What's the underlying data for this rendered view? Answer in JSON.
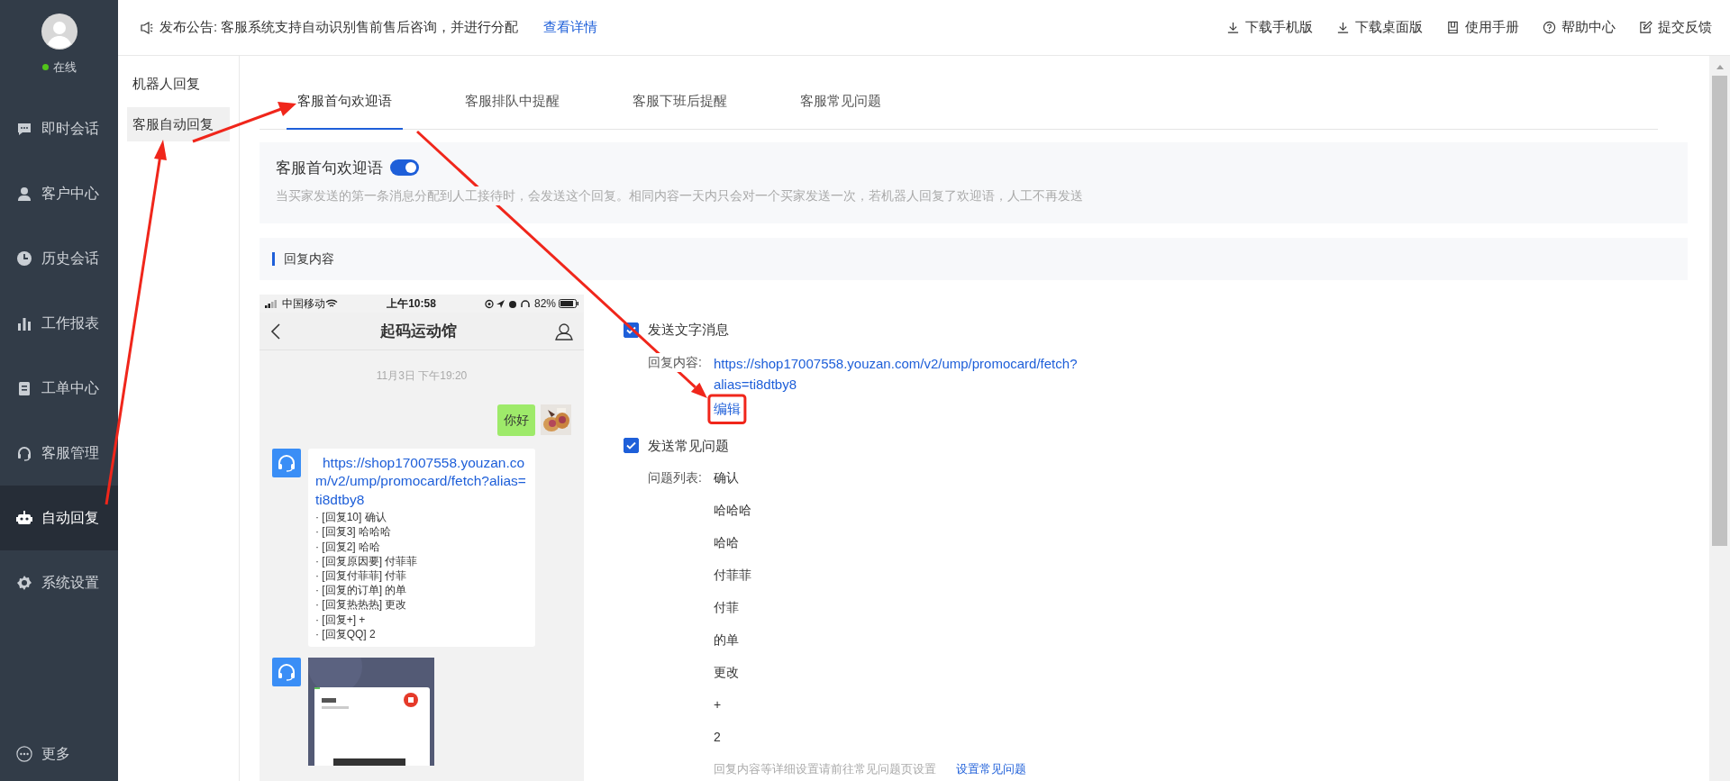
{
  "sidebar": {
    "status": "在线",
    "online": true,
    "items": [
      {
        "label": "即时会话",
        "selected": false
      },
      {
        "label": "客户中心",
        "selected": false
      },
      {
        "label": "历史会话",
        "selected": false
      },
      {
        "label": "工作报表",
        "selected": false
      },
      {
        "label": "工单中心",
        "selected": false
      },
      {
        "label": "客服管理",
        "selected": false
      },
      {
        "label": "自动回复",
        "selected": true
      },
      {
        "label": "系统设置",
        "selected": false
      }
    ],
    "more": "更多"
  },
  "announcement": {
    "text": "发布公告: 客服系统支持自动识别售前售后咨询，并进行分配",
    "link": "查看详情"
  },
  "toolbar": [
    "下载手机版",
    "下载桌面版",
    "使用手册",
    "帮助中心",
    "提交反馈"
  ],
  "subnav": [
    {
      "label": "机器人回复",
      "selected": false
    },
    {
      "label": "客服自动回复",
      "selected": true
    }
  ],
  "tabs": [
    {
      "label": "客服首句欢迎语",
      "selected": true
    },
    {
      "label": "客服排队中提醒",
      "selected": false
    },
    {
      "label": "客服下班后提醒",
      "selected": false
    },
    {
      "label": "客服常见问题",
      "selected": false
    }
  ],
  "welcome": {
    "title": "客服首句欢迎语",
    "on": true,
    "description": "当买家发送的第一条消息分配到人工接待时，会发送这个回复。相同内容一天内只会对一个买家发送一次，若机器人回复了欢迎语，人工不再发送"
  },
  "section_title": "回复内容",
  "phone": {
    "carrier": "中国移动",
    "time": "上午10:58",
    "battery": "82%",
    "title": "起码运动馆",
    "timestamp": "11月3日 下午19:20",
    "user_message": "你好",
    "bot_link": "https://shop17007558.youzan.com/v2/ump/promocard/fetch?alias=ti8dtby8",
    "bot_lines": [
      "· [回复10] 确认",
      "· [回复3] 哈哈哈",
      "· [回复2] 哈哈",
      "· [回复原因要] 付菲菲",
      "· [回复付菲菲] 付菲",
      "· [回复的订单] 的单",
      "· [回复热热热] 更改",
      "· [回复+] +",
      "· [回复QQ] 2"
    ]
  },
  "send_text": {
    "label": "发送文字消息",
    "checked": true,
    "field_label": "回复内容:",
    "link": "https://shop17007558.youzan.com/v2/ump/promocard/fetch?alias=ti8dtby8",
    "edit": "编辑"
  },
  "send_faq": {
    "label": "发送常见问题",
    "checked": true,
    "field_label": "问题列表:",
    "questions": [
      "确认",
      "哈哈哈",
      "哈哈",
      "付菲菲",
      "付菲",
      "的单",
      "更改",
      "+",
      "2"
    ],
    "note": "回复内容等详细设置请前往常见问题页设置",
    "link": "设置常见问题"
  }
}
